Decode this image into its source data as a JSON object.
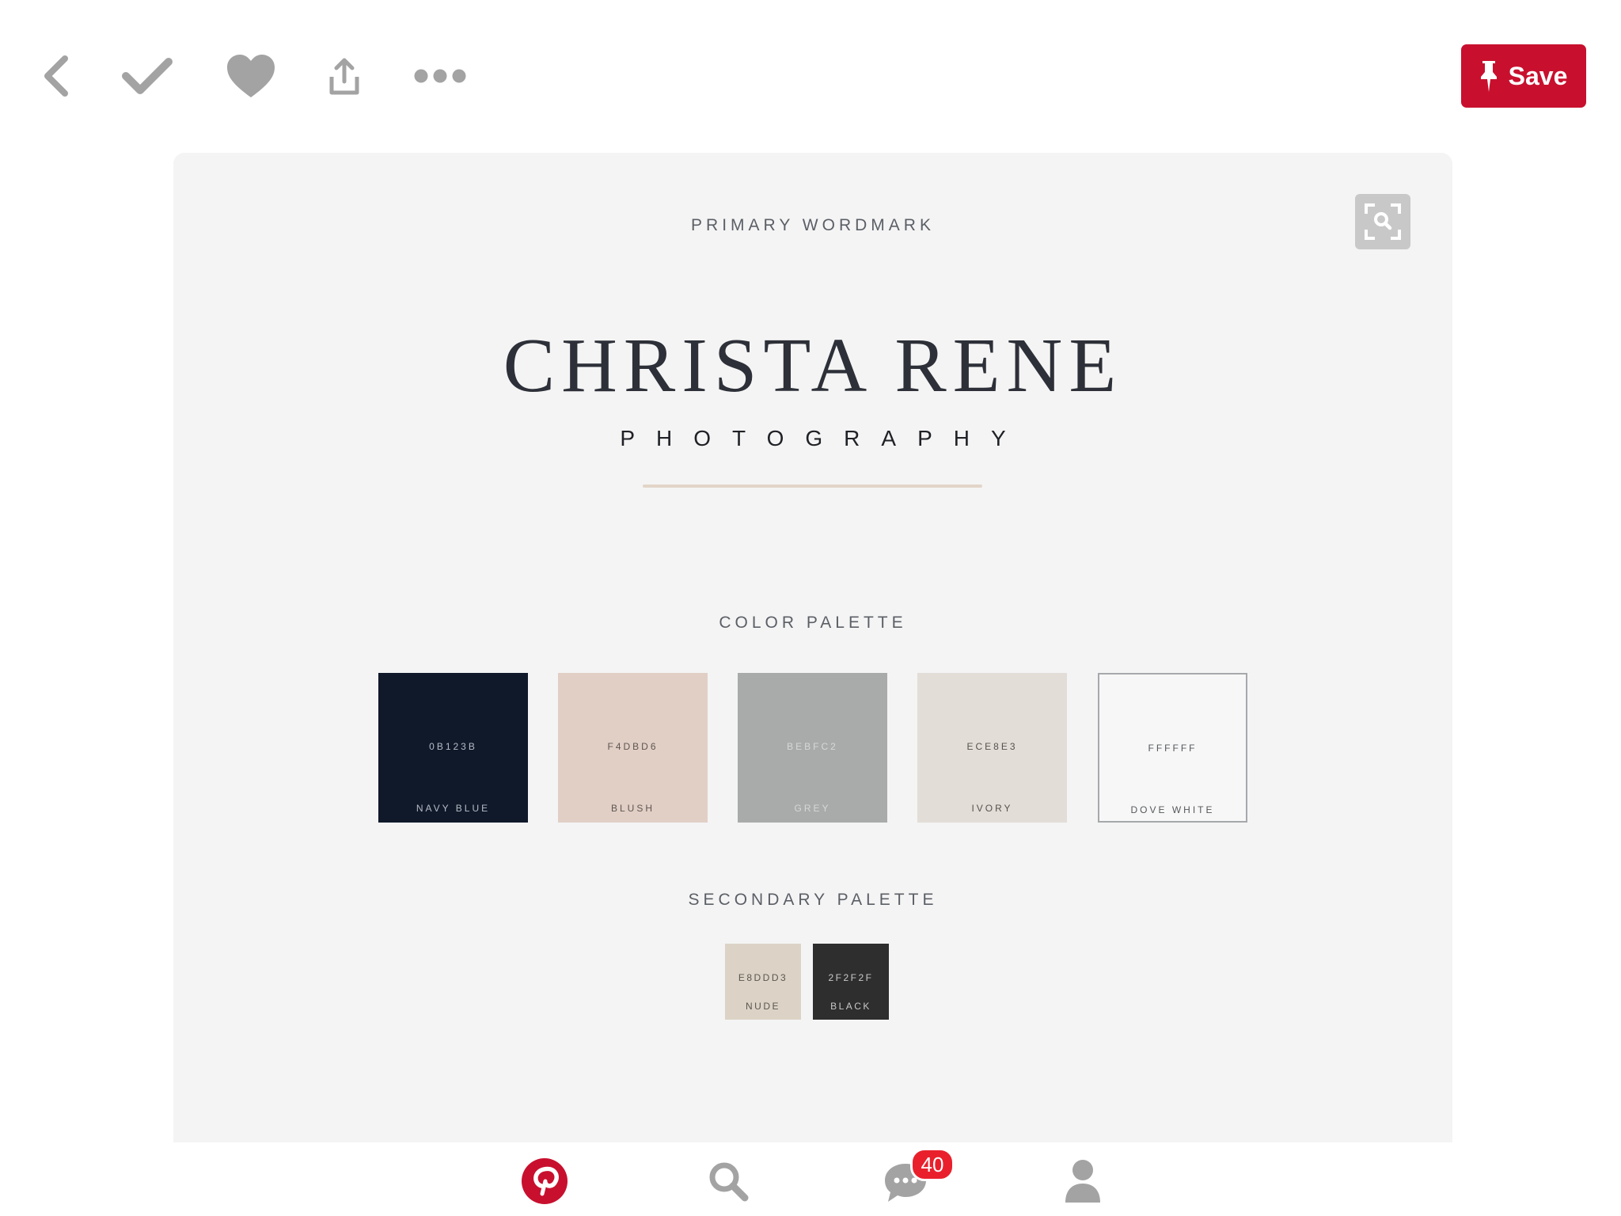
{
  "toolbar": {
    "back_icon": "chevron-left-icon",
    "done_icon": "checkmark-icon",
    "like_icon": "heart-icon",
    "share_icon": "share-icon",
    "more_icon": "ellipsis-icon",
    "save_label": "Save",
    "save_color": "#c8102e"
  },
  "pin": {
    "zoom_icon": "visual-search-icon",
    "wordmark_caption": "PRIMARY WORDMARK",
    "brand_name": "CHRISTA RENE",
    "brand_sub": "PHOTOGRAPHY",
    "color_palette_caption": "COLOR PALETTE",
    "secondary_palette_caption": "SECONDARY PALETTE",
    "palette": [
      {
        "hex": "0B123B",
        "name": "NAVY BLUE",
        "color": "#0f192a"
      },
      {
        "hex": "F4DBD6",
        "name": "BLUSH",
        "color": "#e1cfc6"
      },
      {
        "hex": "BEBFC2",
        "name": "GREY",
        "color": "#a9abab"
      },
      {
        "hex": "ECE8E3",
        "name": "IVORY",
        "color": "#e2ddd7"
      },
      {
        "hex": "FFFFFF",
        "name": "DOVE WHITE",
        "color": "#f7f7f7"
      }
    ],
    "secondary": [
      {
        "hex": "E8DDD3",
        "name": "NUDE",
        "color": "#dcd3c6"
      },
      {
        "hex": "2F2F2F",
        "name": "BLACK",
        "color": "#2e2e2e"
      }
    ]
  },
  "tabbar": {
    "home_icon": "pinterest-logo-icon",
    "search_icon": "search-icon",
    "messages_icon": "chat-bubble-icon",
    "profile_icon": "profile-icon",
    "messages_badge": "40",
    "accent": "#c8102e"
  }
}
